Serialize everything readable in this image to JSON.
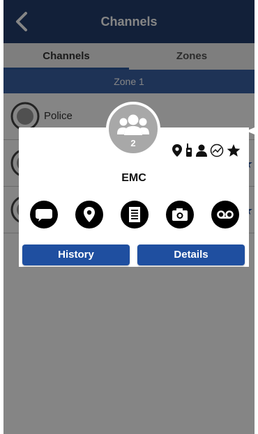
{
  "header": {
    "title": "Channels",
    "back_icon": "chevron-left-icon"
  },
  "tabs": [
    {
      "label": "Channels",
      "active": true
    },
    {
      "label": "Zones",
      "active": false
    }
  ],
  "zone": {
    "label": "Zone 1"
  },
  "channels": [
    {
      "name": "Police",
      "starred": false
    },
    {
      "name": "",
      "starred": true
    },
    {
      "name": "",
      "starred": true
    }
  ],
  "contact_card": {
    "member_count": "2",
    "name": "EMC",
    "status_icons": [
      "location-pin-icon",
      "radio-icon",
      "person-icon",
      "activity-icon",
      "star-icon"
    ],
    "actions": [
      "message-icon",
      "location-icon",
      "document-icon",
      "camera-icon",
      "voicemail-icon"
    ],
    "history_label": "History",
    "details_label": "Details"
  },
  "colors": {
    "header": "#233f6e",
    "zone_bar": "#3a62a6",
    "button": "#1f4fa0",
    "star": "#1f4d9a"
  }
}
